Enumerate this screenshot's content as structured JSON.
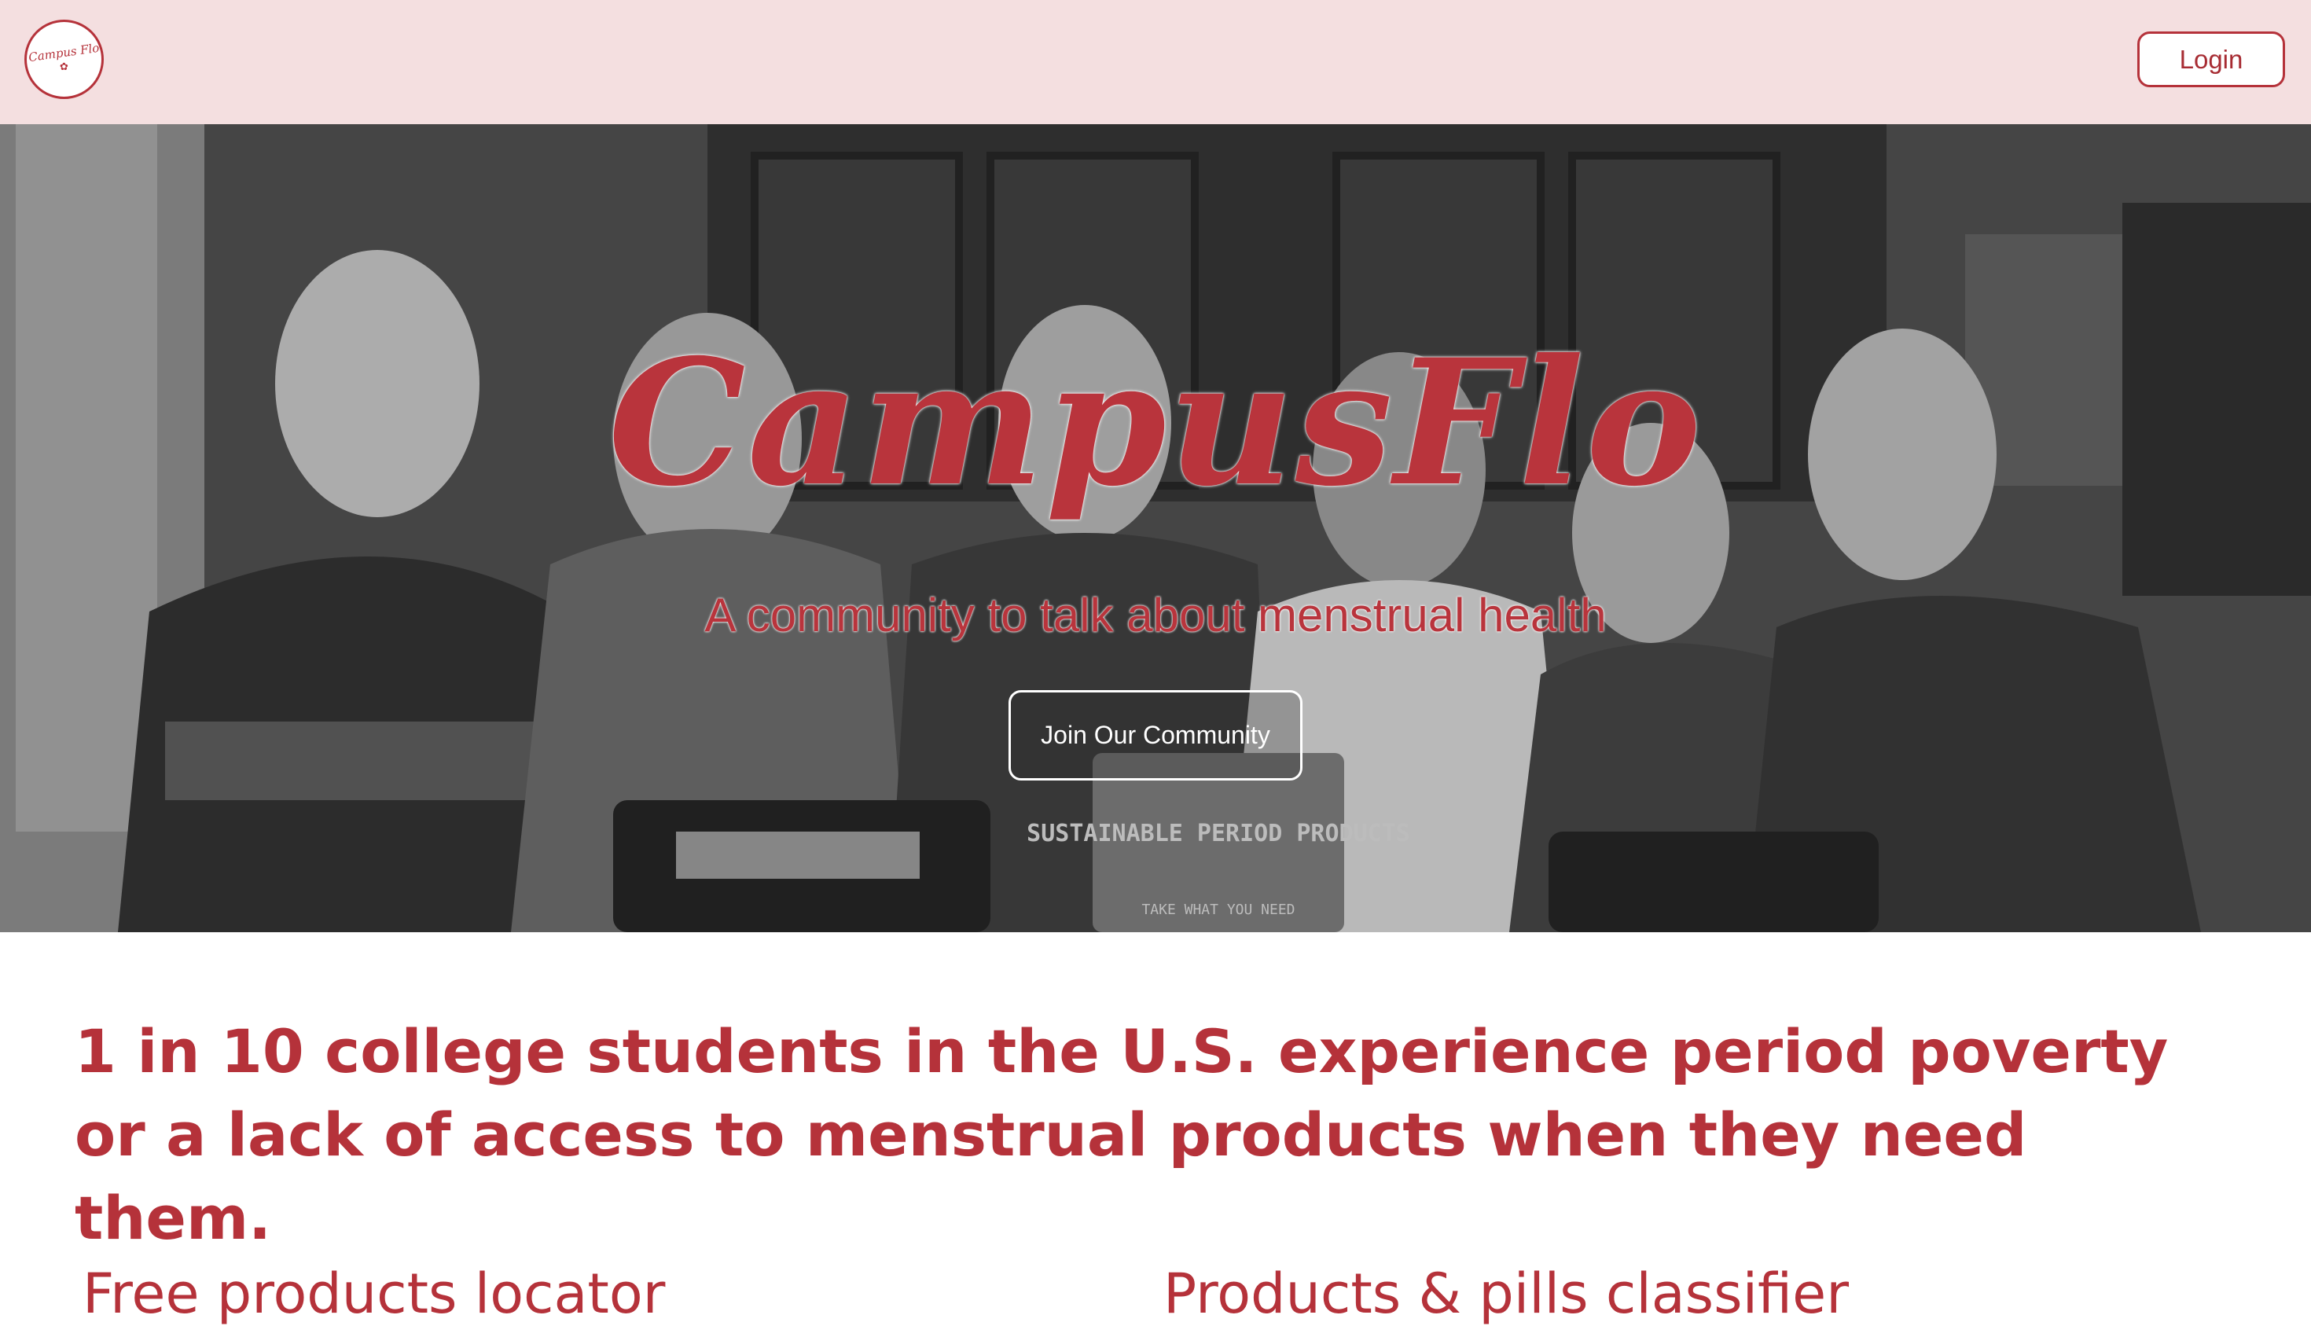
{
  "header": {
    "logo_text": "Campus Flo",
    "login_label": "Login"
  },
  "hero": {
    "title": "CampusFlo",
    "subtitle": "A community to talk about menstrual health",
    "cta_label": "Join Our Community",
    "photo_sign_text": "SUSTAINABLE PERIOD PRODUCTS",
    "photo_sign_subtext": "TAKE WHAT YOU NEED"
  },
  "main": {
    "stat_text": "1 in 10 college students in the U.S. experience period poverty or a lack of access to menstrual products when they need them.",
    "features": [
      {
        "title": "Free products locator"
      },
      {
        "title": "Products & pills classifier"
      }
    ]
  },
  "colors": {
    "brand_red": "#b5323a",
    "header_bg": "#f4dfe0"
  }
}
